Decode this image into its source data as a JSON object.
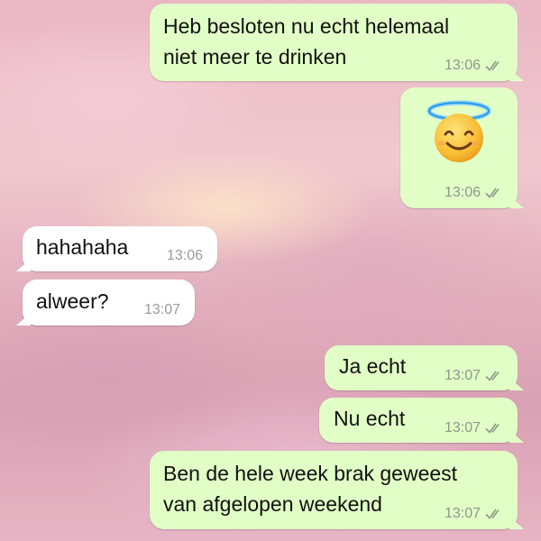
{
  "messages": [
    {
      "direction": "outgoing",
      "lines": [
        "Heb besloten nu echt helemaal",
        "niet meer te drinken"
      ],
      "time": "13:06",
      "status": "read"
    },
    {
      "direction": "outgoing",
      "emoji": "smiling face with halo",
      "time": "13:06",
      "status": "read"
    },
    {
      "direction": "incoming",
      "lines": [
        "hahahaha"
      ],
      "time": "13:06"
    },
    {
      "direction": "incoming",
      "lines": [
        "alweer?"
      ],
      "time": "13:07"
    },
    {
      "direction": "outgoing",
      "lines": [
        "Ja echt"
      ],
      "time": "13:07",
      "status": "read"
    },
    {
      "direction": "outgoing",
      "lines": [
        "Nu echt"
      ],
      "time": "13:07",
      "status": "read"
    },
    {
      "direction": "outgoing",
      "lines": [
        "Ben de hele week brak geweest",
        "van afgelopen weekend"
      ],
      "time": "13:07",
      "status": "read"
    }
  ],
  "colors": {
    "outgoing_bubble": "#e1fec6",
    "incoming_bubble": "#ffffff",
    "timestamp": "#8a9a8a",
    "wallpaper": "#e6b4c4"
  },
  "icons": {
    "read_receipt": "double-check-icon",
    "emoji": "halo-smile-emoji-icon"
  }
}
